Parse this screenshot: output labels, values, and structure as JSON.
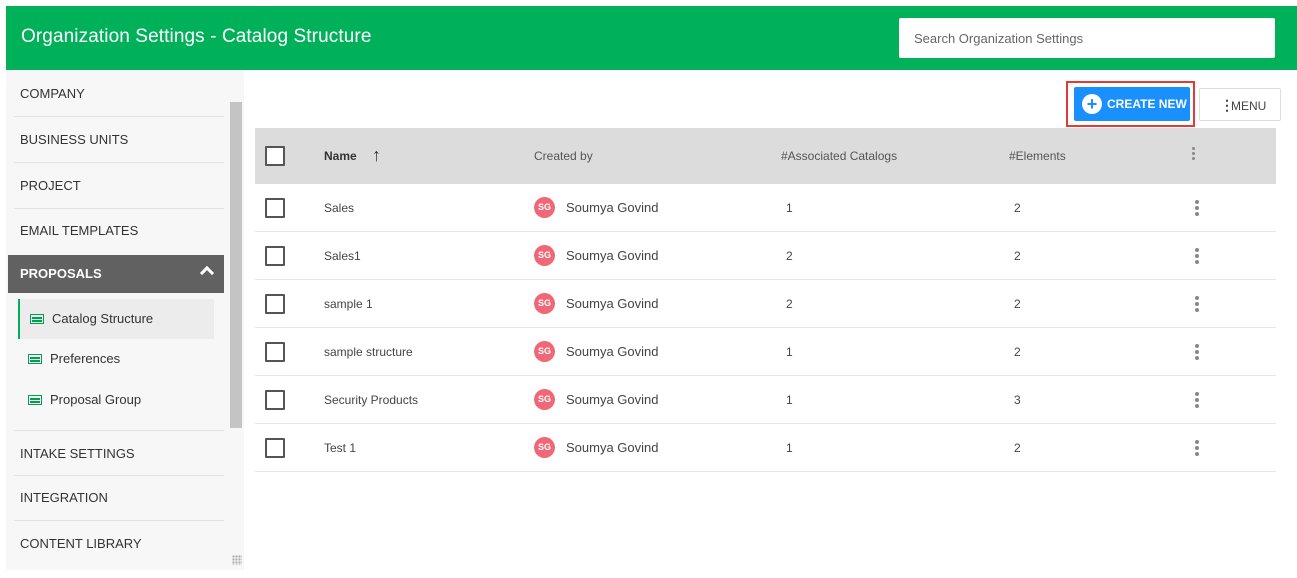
{
  "header": {
    "title": "Organization Settings - Catalog Structure",
    "search_placeholder": "Search Organization Settings"
  },
  "sidebar": {
    "items_top": [
      "COMPANY",
      "BUSINESS UNITS",
      "PROJECT",
      "EMAIL TEMPLATES"
    ],
    "active_section": "PROPOSALS",
    "sub_items": [
      "Catalog Structure",
      "Preferences",
      "Proposal Group"
    ],
    "items_bottom": [
      "INTAKE SETTINGS",
      "INTEGRATION",
      "CONTENT LIBRARY"
    ]
  },
  "toolbar": {
    "create_label": "CREATE NEW",
    "menu_label": "MENU"
  },
  "table": {
    "columns": [
      "Name",
      "Created by",
      "#Associated Catalogs",
      "#Elements"
    ],
    "rows": [
      {
        "name": "Sales",
        "initials": "SG",
        "created_by": "Soumya Govind",
        "catalogs": "1",
        "elements": "2"
      },
      {
        "name": "Sales1",
        "initials": "SG",
        "created_by": "Soumya Govind",
        "catalogs": "2",
        "elements": "2"
      },
      {
        "name": "sample 1",
        "initials": "SG",
        "created_by": "Soumya Govind",
        "catalogs": "2",
        "elements": "2"
      },
      {
        "name": "sample structure",
        "initials": "SG",
        "created_by": "Soumya Govind",
        "catalogs": "1",
        "elements": "2"
      },
      {
        "name": "Security Products",
        "initials": "SG",
        "created_by": "Soumya Govind",
        "catalogs": "1",
        "elements": "3"
      },
      {
        "name": "Test 1",
        "initials": "SG",
        "created_by": "Soumya Govind",
        "catalogs": "1",
        "elements": "2"
      }
    ]
  },
  "colors": {
    "brand_green": "#00b15a",
    "primary_blue": "#1a90ff",
    "avatar_pink": "#f06778",
    "highlight_red": "#e53935"
  }
}
